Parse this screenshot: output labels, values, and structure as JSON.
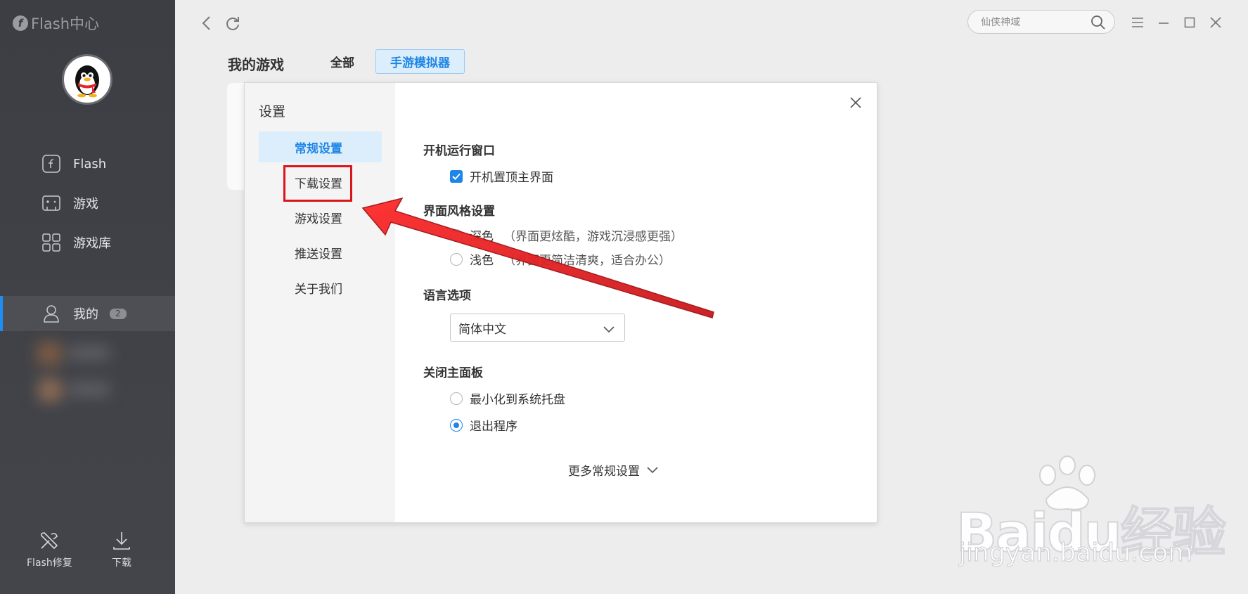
{
  "app": {
    "brand": "Flash中心"
  },
  "sidebar": {
    "nav": [
      {
        "label": "Flash",
        "icon": "flash-icon"
      },
      {
        "label": "游戏",
        "icon": "gamepad-icon"
      },
      {
        "label": "游戏库",
        "icon": "grid-icon"
      }
    ],
    "me": {
      "label": "我的",
      "badge": "2",
      "icon": "user-icon"
    },
    "bottom": [
      {
        "label": "Flash修复",
        "icon": "tools-icon"
      },
      {
        "label": "下载",
        "icon": "download-icon"
      }
    ]
  },
  "search": {
    "placeholder": "仙侠神域"
  },
  "header": {
    "title": "我的游戏",
    "tabs": [
      "全部",
      "手游模拟器"
    ],
    "active_tab": "手游模拟器"
  },
  "settings": {
    "title": "设置",
    "menu": [
      "常规设置",
      "下载设置",
      "游戏设置",
      "推送设置",
      "关于我们"
    ],
    "selected": "常规设置",
    "startup": {
      "title": "开机运行窗口",
      "checkbox_label": "开机置顶主界面",
      "checked": true
    },
    "theme": {
      "title": "界面风格设置",
      "options": [
        {
          "label": "深色",
          "hint": "（界面更炫酷，游戏沉浸感更强）"
        },
        {
          "label": "浅色",
          "hint": "（界面更简洁清爽，适合办公）"
        }
      ]
    },
    "language": {
      "title": "语言选项",
      "value": "简体中文"
    },
    "close_panel": {
      "title": "关闭主面板",
      "options": [
        "最小化到系统托盘",
        "退出程序"
      ],
      "selected": "退出程序"
    },
    "more": "更多常规设置"
  },
  "watermark": {
    "brand": "Baidu经验",
    "url": "jingyan.baidu.com"
  },
  "colors": {
    "accent": "#1e86e6",
    "sidebar": "#3c3e44",
    "annotation": "#d9161c"
  }
}
